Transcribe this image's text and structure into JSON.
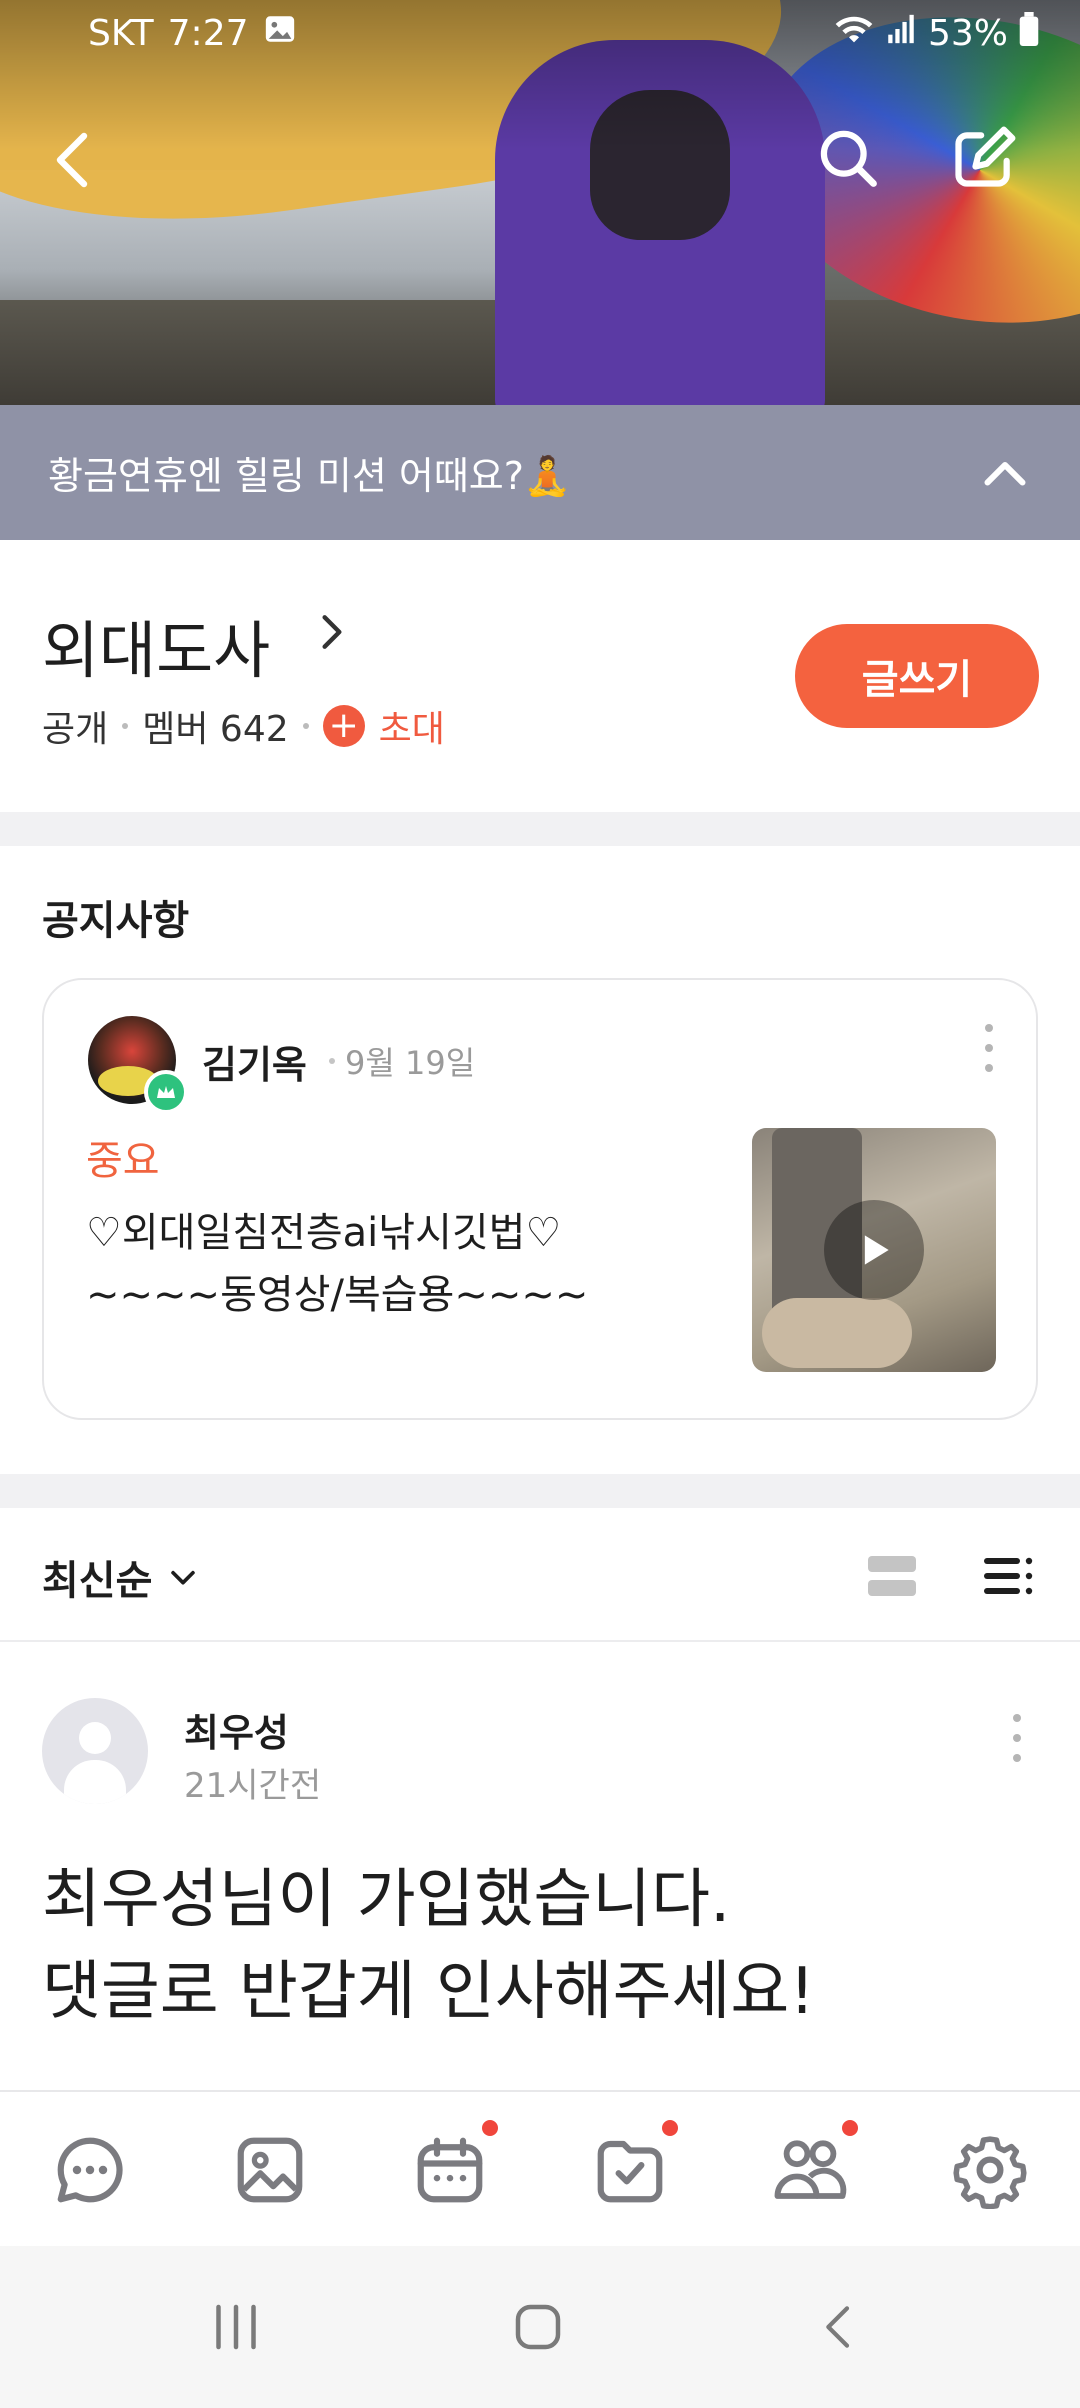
{
  "status_bar": {
    "carrier": "SKT",
    "time": "7:27",
    "battery": "53%"
  },
  "banner": {
    "text": "황금연휴엔 힐링 미션 어때요?🧘"
  },
  "cafe": {
    "name": "외대도사",
    "visibility": "공개",
    "members": "멤버 642",
    "invite": "초대",
    "write_label": "글쓰기"
  },
  "notice": {
    "section_title": "공지사항",
    "author": "김기옥",
    "date": "9월 19일",
    "tag": "중요",
    "line1": "♡외대일침전층ai낚시깃법♡",
    "line2": "~~~~동영상/복습용~~~~"
  },
  "sort": {
    "label": "최신순"
  },
  "post": {
    "author": "최우성",
    "time": "21시간전",
    "body_line1": "최우성님이 가입했습니다.",
    "body_line2": "댓글로 반갑게 인사해주세요!"
  },
  "tabs": [
    {
      "icon": "chat-icon",
      "badge": false
    },
    {
      "icon": "gallery-icon",
      "badge": false
    },
    {
      "icon": "calendar-icon",
      "badge": true
    },
    {
      "icon": "todo-icon",
      "badge": true
    },
    {
      "icon": "members-icon",
      "badge": true
    },
    {
      "icon": "settings-icon",
      "badge": false
    }
  ],
  "colors": {
    "accent": "#f4623f",
    "banner_bg": "#8f92a6",
    "notice_tag": "#f0643f",
    "crown_badge": "#2ec27e"
  }
}
